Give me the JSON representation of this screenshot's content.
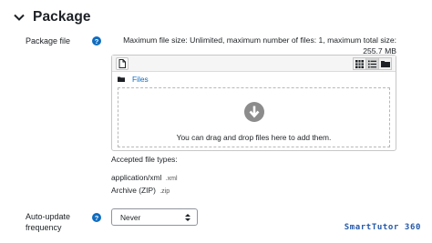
{
  "section": {
    "title": "Package",
    "icon": "chevron-down-icon"
  },
  "package_field": {
    "label": "Package file",
    "help_icon": "?",
    "max_size_line1": "Maximum file size: Unlimited, maximum number of files: 1, maximum total size:",
    "max_size_line2": "255.7 MB",
    "path_label": "Files",
    "drop_text": "You can drag and drop files here to add them.",
    "accepted_label": "Accepted file types:",
    "types": [
      {
        "name": "application/xml",
        "ext": ".xml"
      },
      {
        "name": "Archive (ZIP)",
        "ext": ".zip"
      }
    ]
  },
  "auto_update": {
    "label_line1": "Auto-update",
    "label_line2": "frequency",
    "help_icon": "?",
    "selected": "Never"
  },
  "watermark": "SmartTutor 360",
  "colors": {
    "accent": "#0f6cbf",
    "watermark": "#2458a8"
  }
}
